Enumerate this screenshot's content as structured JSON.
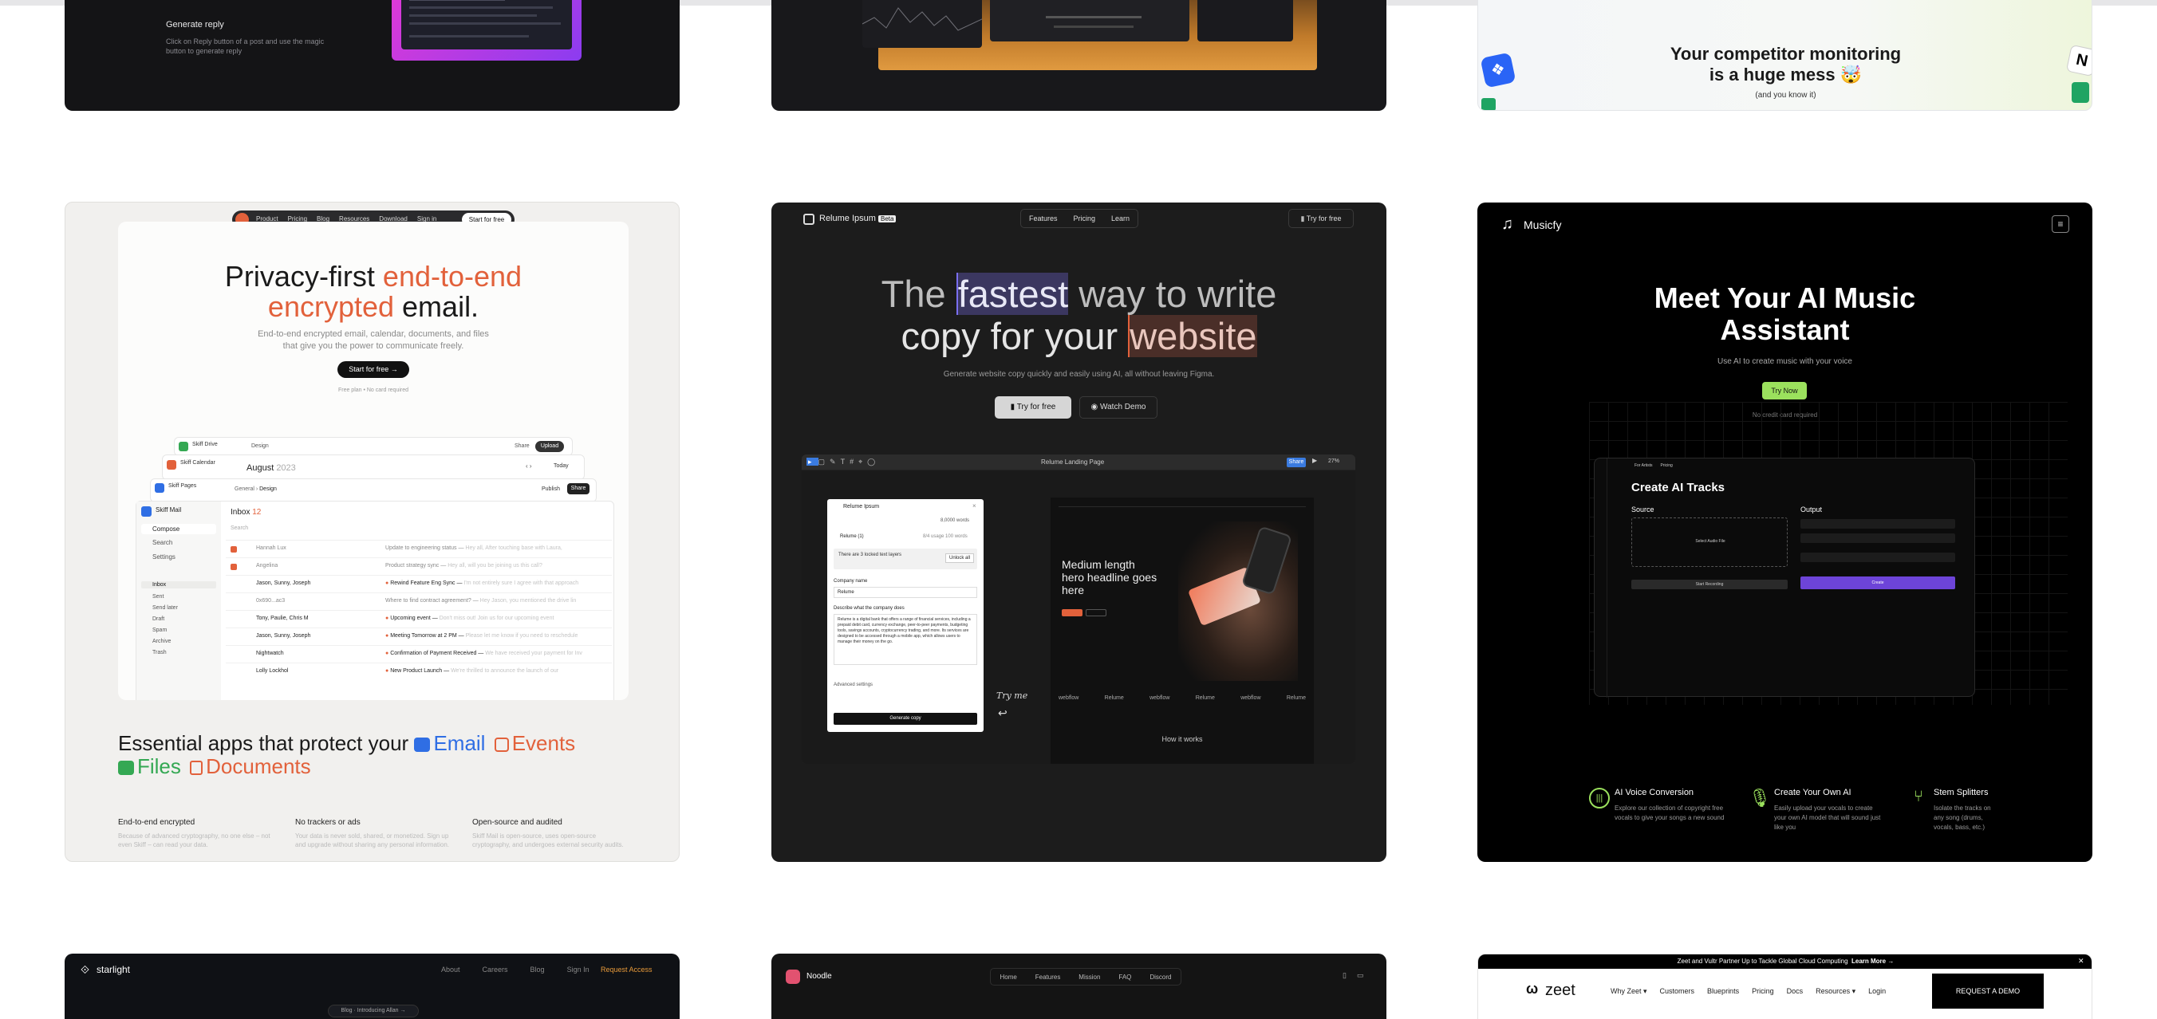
{
  "top_row": {
    "a": {
      "title": "Generate reply",
      "desc": "Click on Reply button of a post and use the magic button to generate reply"
    },
    "c": {
      "headline1": "Your competitor monitoring",
      "headline2": "is a huge mess 🤯",
      "sub": "(and you know it)"
    }
  },
  "skiff": {
    "nav": [
      "Product",
      "Pricing",
      "Blog",
      "Resources",
      "Download",
      "Sign in"
    ],
    "nav_cta": "Start for free",
    "h1_a": "Privacy-first ",
    "h1_b": "end-to-end",
    "h1_c": "encrypted",
    "h1_d": " email.",
    "sub": "End-to-end encrypted email, calendar, documents, and files that give you the power to communicate freely.",
    "cta": "Start for free →",
    "note": "Free plan • No card required",
    "apps": [
      "Skiff Drive",
      "Skiff Calendar",
      "Skiff Pages",
      "Skiff Mail"
    ],
    "calendar_month": "August",
    "calendar_year": "2023",
    "today": "Today",
    "doc_crumb": "Design",
    "share": "Share",
    "upload": "Upload",
    "publish": "Publish",
    "sidebar": [
      "Compose",
      "Search",
      "Settings"
    ],
    "sidebar_folders": [
      "Inbox",
      "Sent",
      "Send later",
      "Draft",
      "Spam",
      "Archive",
      "Trash"
    ],
    "inbox_label": "Inbox",
    "inbox_count": "12",
    "mail_search": "Search",
    "mails": [
      {
        "from": "Hannah Lux",
        "subject": "Update to engineering status",
        "preview": "Hey all, After touching base with Laura,"
      },
      {
        "from": "Angelina",
        "subject": "Product strategy sync",
        "preview": "Hey all, will you be joining us this call?"
      },
      {
        "from": "Jason, Sunny, Joseph",
        "subject": "Rewind Feature Eng Sync",
        "preview": "I'm not entirely sure I agree with that approach"
      },
      {
        "from": "0x690...ac3",
        "subject": "Where to find contract agreement?",
        "preview": "Hey Jason, you mentioned the drive lin"
      },
      {
        "from": "Tony, Paulie, Chris M",
        "subject": "Upcoming event",
        "preview": "Don't miss out! Join us for our upcoming event"
      },
      {
        "from": "Jason, Sunny, Joseph",
        "subject": "Meeting Tomorrow at 2 PM",
        "preview": "Please let me know if you need to reschedule"
      },
      {
        "from": "Nightwatch",
        "subject": "Confirmation of Payment Received",
        "preview": "We have received your payment for Inv"
      },
      {
        "from": "Lolly Lockhol",
        "subject": "New Product Launch",
        "preview": "We're thrilled to announce the launch of our"
      }
    ],
    "essential_a": "Essential apps that protect your ",
    "essential_email": "Email",
    "essential_events": "Events",
    "essential_files": "Files",
    "essential_docs": "Documents",
    "features": [
      {
        "title": "End-to-end encrypted",
        "desc": "Because of advanced cryptography, no one else – not even Skiff – can read your data."
      },
      {
        "title": "No trackers or ads",
        "desc": "Your data is never sold, shared, or monetized. Sign up and upgrade without sharing any personal information."
      },
      {
        "title": "Open-source and audited",
        "desc": "Skiff Mail is open-source, uses open-source cryptography, and undergoes external security audits."
      }
    ]
  },
  "relume": {
    "brand": "Relume Ipsum",
    "badge": "Beta",
    "nav": [
      "Features",
      "Pricing",
      "Learn"
    ],
    "nav_cta": "Try for free",
    "h_the": "The ",
    "h_fastest": "fastest",
    "h_rest": " way to write",
    "h_line2a": "copy for your ",
    "h_website": "website",
    "sub": "Generate website copy quickly and easily using AI, all without leaving Figma.",
    "cta1": "Try for free",
    "cta2": "Watch Demo",
    "figma_title": "Relume Landing Page",
    "share": "Share",
    "zoom": "27%",
    "plugin_title": "Relume Ipsum",
    "words_used": "8,0000 words",
    "plugin_tab": "Relume (1)",
    "words_left": "8/4 usage 100 words",
    "unlock_text": "There are 3 locked text layers",
    "unlock_btn": "Unlock all",
    "company_label": "Company name",
    "company_value": "Relume",
    "describe_label": "Describe what the company does",
    "describe_value": "Relume is a digital bank that offers a range of financial services, including a prepaid debit card, currency exchange, peer-to-peer payments, budgeting tools, savings accounts, cryptocurrency trading, and more. Its services are designed to be accessed through a mobile app, which allows users to manage their money on the go.",
    "advanced": "Advanced settings",
    "generate": "Generate copy",
    "hero_text": "Medium length hero headline goes here",
    "try_me": "Try me",
    "how_it_works": "How it works",
    "logos": [
      "webflow",
      "Relume",
      "webflow",
      "Relume",
      "webflow",
      "Relume"
    ]
  },
  "musicfy": {
    "brand": "Musicfy",
    "h1": "Meet Your AI Music",
    "h2": "Assistant",
    "sub": "Use AI to create music with your voice",
    "cta": "Try Now",
    "note": "No credit card required",
    "app_title": "Create AI Tracks",
    "app_nav": [
      "For Artists",
      "Pricing"
    ],
    "source": "Source",
    "output": "Output",
    "upload": "Select Audio File",
    "start": "Start Recording",
    "create": "Create",
    "features": [
      {
        "title": "AI Voice Conversion",
        "desc": "Explore our collection of copyright free vocals to give your songs a new sound"
      },
      {
        "title": "Create Your Own AI",
        "desc": "Easily upload your vocals to create your own AI model that will sound just like you"
      },
      {
        "title": "Stem Splitters",
        "desc": "Isolate the tracks on any song (drums, vocals, bass, etc.)"
      }
    ]
  },
  "bottom": {
    "starlight": {
      "brand": "starlight",
      "nav": [
        "About",
        "Careers",
        "Blog",
        "Sign In"
      ],
      "cta": "Request Access",
      "pill": "Blog · Introducing Allan →"
    },
    "noodle": {
      "brand": "Noodle",
      "nav": [
        "Home",
        "Features",
        "Mission",
        "FAQ",
        "Discord"
      ]
    },
    "zeet": {
      "banner": "Zeet and Vultr Partner Up to Tackle Global Cloud Computing",
      "banner_link": "Learn More →",
      "brand": "zeet",
      "nav": [
        "Why Zeet ▾",
        "Customers",
        "Blueprints",
        "Pricing",
        "Docs",
        "Resources ▾",
        "Login"
      ],
      "cta": "REQUEST A DEMO"
    }
  },
  "colors": {
    "skiff_accent": "#e2613b",
    "relume_highlight": "#3b3760",
    "musicfy_green": "#9be15d",
    "musicfy_purple": "#6d44d8"
  }
}
